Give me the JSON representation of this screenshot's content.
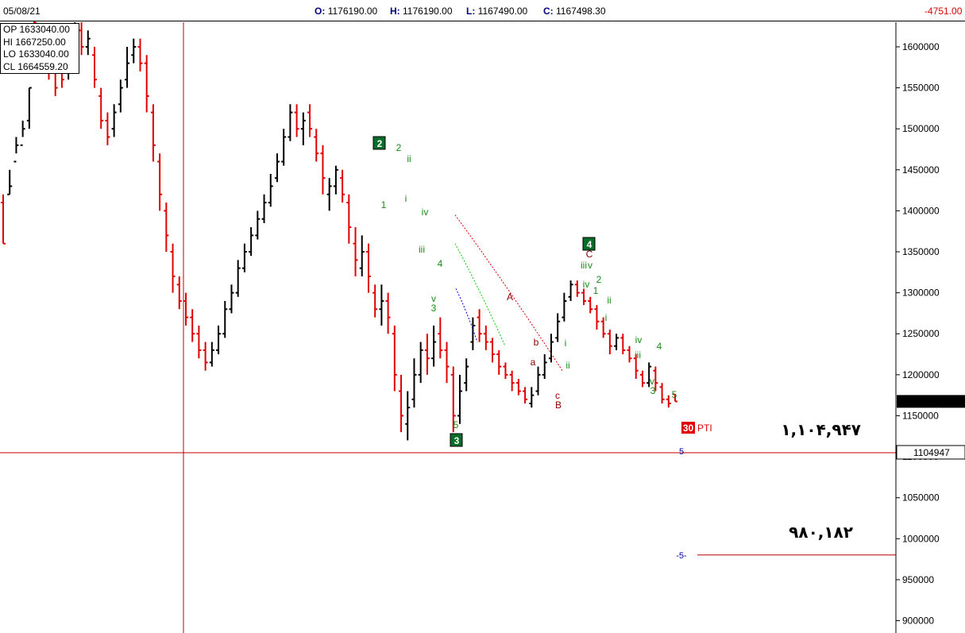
{
  "header": {
    "date": "05/08/21",
    "open_label": "O:",
    "open": "1176190.00",
    "high_label": "H:",
    "high": "1176190.00",
    "low_label": "L:",
    "low": "1167490.00",
    "close_label": "C:",
    "close": "1167498.30",
    "change": "-4751.00"
  },
  "cursor_box": {
    "op_label": "OP",
    "op": "1633040.00",
    "hi_label": "HI",
    "hi": "1667250.00",
    "lo_label": "LO",
    "lo": "1633040.00",
    "cl_label": "CL",
    "cl": "1664559.20"
  },
  "colors": {
    "up": "#000000",
    "down": "#e00000",
    "wave_green": "#1a8a1a",
    "wave_maroon": "#8b0000",
    "badge_green": "#0a6e2a",
    "channel_red": "#e00000",
    "channel_green": "#00cc00",
    "channel_blue": "#0000cc",
    "crosshair": "#c00000",
    "pti_red": "#e00000",
    "projection_blue": "#0000aa"
  },
  "chart_data": {
    "type": "bar",
    "title": "",
    "ylim": [
      885000,
      1630000
    ],
    "y_ticks": [
      900000,
      950000,
      1000000,
      1050000,
      1100000,
      1150000,
      1200000,
      1250000,
      1300000,
      1350000,
      1400000,
      1450000,
      1500000,
      1550000,
      1600000
    ],
    "y_tick_labels": [
      "900000",
      "950000",
      "1000000",
      "1050000",
      "1100000",
      "1150000",
      "1200000",
      "1250000",
      "1300000",
      "1350000",
      "1400000",
      "1450000",
      "1500000",
      "1550000",
      "1600000"
    ],
    "last_price": 1167498,
    "last_price_label": "1167498",
    "crosshair_price": 1104947,
    "crosshair_price_label": "1104947",
    "target_levels": [
      {
        "value": 1104947,
        "text": "۱,۱۰۴,۹۴۷"
      },
      {
        "value": 980182,
        "text": "۹۸۰,۱۸۲"
      }
    ],
    "pti": {
      "number": "30",
      "text": "PTI"
    },
    "projections": [
      {
        "value": 1104947,
        "text": "5"
      },
      {
        "value": 980182,
        "text": "-5-"
      }
    ],
    "bars": [
      [
        1410000,
        1360000,
        1420000,
        1360000
      ],
      [
        1420000,
        1430000,
        1450000,
        1420000
      ],
      [
        1460000,
        1480000,
        1470000,
        1490000
      ],
      [
        1480000,
        1500000,
        1490000,
        1510000
      ],
      [
        1510000,
        1550000,
        1500000,
        1550000
      ],
      [
        1630000,
        1610000,
        1630000,
        1600000
      ],
      [
        1620000,
        1600000,
        1620000,
        1590000
      ],
      [
        1600000,
        1570000,
        1610000,
        1560000
      ],
      [
        1580000,
        1550000,
        1590000,
        1540000
      ],
      [
        1590000,
        1560000,
        1600000,
        1550000
      ],
      [
        1580000,
        1600000,
        1560000,
        1610000
      ],
      [
        1600000,
        1620000,
        1590000,
        1630000
      ],
      [
        1620000,
        1600000,
        1630000,
        1590000
      ],
      [
        1600000,
        1610000,
        1590000,
        1620000
      ],
      [
        1590000,
        1560000,
        1600000,
        1550000
      ],
      [
        1540000,
        1510000,
        1550000,
        1500000
      ],
      [
        1510000,
        1490000,
        1520000,
        1480000
      ],
      [
        1500000,
        1520000,
        1490000,
        1530000
      ],
      [
        1530000,
        1550000,
        1520000,
        1560000
      ],
      [
        1560000,
        1580000,
        1550000,
        1600000
      ],
      [
        1590000,
        1600000,
        1580000,
        1610000
      ],
      [
        1600000,
        1580000,
        1610000,
        1570000
      ],
      [
        1580000,
        1540000,
        1590000,
        1520000
      ],
      [
        1520000,
        1480000,
        1530000,
        1460000
      ],
      [
        1460000,
        1420000,
        1470000,
        1400000
      ],
      [
        1400000,
        1370000,
        1410000,
        1350000
      ],
      [
        1350000,
        1320000,
        1360000,
        1300000
      ],
      [
        1310000,
        1290000,
        1320000,
        1280000
      ],
      [
        1290000,
        1270000,
        1300000,
        1260000
      ],
      [
        1270000,
        1250000,
        1280000,
        1240000
      ],
      [
        1250000,
        1230000,
        1260000,
        1220000
      ],
      [
        1230000,
        1215000,
        1240000,
        1205000
      ],
      [
        1215000,
        1230000,
        1210000,
        1240000
      ],
      [
        1230000,
        1250000,
        1225000,
        1260000
      ],
      [
        1250000,
        1280000,
        1245000,
        1290000
      ],
      [
        1280000,
        1300000,
        1275000,
        1310000
      ],
      [
        1300000,
        1330000,
        1295000,
        1340000
      ],
      [
        1330000,
        1350000,
        1325000,
        1360000
      ],
      [
        1350000,
        1370000,
        1345000,
        1380000
      ],
      [
        1370000,
        1390000,
        1365000,
        1400000
      ],
      [
        1390000,
        1410000,
        1385000,
        1420000
      ],
      [
        1410000,
        1430000,
        1405000,
        1445000
      ],
      [
        1440000,
        1460000,
        1435000,
        1470000
      ],
      [
        1460000,
        1490000,
        1455000,
        1500000
      ],
      [
        1490000,
        1520000,
        1485000,
        1530000
      ],
      [
        1520000,
        1500000,
        1530000,
        1490000
      ],
      [
        1500000,
        1510000,
        1480000,
        1520000
      ],
      [
        1520000,
        1500000,
        1530000,
        1490000
      ],
      [
        1490000,
        1470000,
        1500000,
        1460000
      ],
      [
        1470000,
        1440000,
        1480000,
        1420000
      ],
      [
        1420000,
        1430000,
        1400000,
        1440000
      ],
      [
        1430000,
        1450000,
        1420000,
        1455000
      ],
      [
        1440000,
        1420000,
        1450000,
        1410000
      ],
      [
        1410000,
        1380000,
        1420000,
        1360000
      ],
      [
        1360000,
        1340000,
        1380000,
        1320000
      ],
      [
        1330000,
        1350000,
        1320000,
        1370000
      ],
      [
        1350000,
        1320000,
        1360000,
        1300000
      ],
      [
        1300000,
        1280000,
        1310000,
        1270000
      ],
      [
        1280000,
        1290000,
        1260000,
        1310000
      ],
      [
        1290000,
        1270000,
        1300000,
        1250000
      ],
      [
        1250000,
        1200000,
        1260000,
        1180000
      ],
      [
        1180000,
        1150000,
        1200000,
        1130000
      ],
      [
        1140000,
        1160000,
        1120000,
        1180000
      ],
      [
        1170000,
        1200000,
        1160000,
        1220000
      ],
      [
        1200000,
        1230000,
        1190000,
        1240000
      ],
      [
        1230000,
        1220000,
        1250000,
        1200000
      ],
      [
        1220000,
        1240000,
        1210000,
        1260000
      ],
      [
        1250000,
        1230000,
        1270000,
        1220000
      ],
      [
        1230000,
        1210000,
        1240000,
        1190000
      ],
      [
        1200000,
        1150000,
        1210000,
        1130000
      ],
      [
        1150000,
        1180000,
        1140000,
        1200000
      ],
      [
        1190000,
        1210000,
        1180000,
        1220000
      ],
      [
        1240000,
        1260000,
        1230000,
        1270000
      ],
      [
        1270000,
        1250000,
        1280000,
        1240000
      ],
      [
        1250000,
        1240000,
        1260000,
        1230000
      ],
      [
        1240000,
        1225000,
        1245000,
        1215000
      ],
      [
        1225000,
        1210000,
        1230000,
        1200000
      ],
      [
        1210000,
        1200000,
        1215000,
        1195000
      ],
      [
        1200000,
        1190000,
        1205000,
        1180000
      ],
      [
        1190000,
        1180000,
        1195000,
        1175000
      ],
      [
        1180000,
        1170000,
        1185000,
        1165000
      ],
      [
        1165000,
        1175000,
        1160000,
        1185000
      ],
      [
        1180000,
        1200000,
        1175000,
        1210000
      ],
      [
        1200000,
        1215000,
        1195000,
        1225000
      ],
      [
        1220000,
        1240000,
        1215000,
        1250000
      ],
      [
        1245000,
        1265000,
        1240000,
        1275000
      ],
      [
        1270000,
        1290000,
        1265000,
        1300000
      ],
      [
        1295000,
        1310000,
        1290000,
        1315000
      ],
      [
        1310000,
        1300000,
        1315000,
        1295000
      ],
      [
        1300000,
        1290000,
        1305000,
        1285000
      ],
      [
        1290000,
        1280000,
        1295000,
        1275000
      ],
      [
        1280000,
        1265000,
        1285000,
        1255000
      ],
      [
        1265000,
        1250000,
        1270000,
        1245000
      ],
      [
        1250000,
        1235000,
        1255000,
        1225000
      ],
      [
        1235000,
        1245000,
        1230000,
        1250000
      ],
      [
        1245000,
        1230000,
        1250000,
        1225000
      ],
      [
        1230000,
        1220000,
        1235000,
        1215000
      ],
      [
        1220000,
        1205000,
        1225000,
        1195000
      ],
      [
        1200000,
        1190000,
        1205000,
        1185000
      ],
      [
        1190000,
        1210000,
        1185000,
        1215000
      ],
      [
        1205000,
        1190000,
        1210000,
        1180000
      ],
      [
        1185000,
        1170000,
        1190000,
        1165000
      ],
      [
        1170000,
        1165000,
        1175000,
        1160000
      ],
      [
        1176190,
        1167498,
        1176190,
        1167490
      ]
    ],
    "channels": [
      {
        "color": "red",
        "from": [
          1395000
        ],
        "to": [
          1205000
        ]
      },
      {
        "color": "green",
        "from": [
          1360000
        ],
        "to": [
          1235000
        ]
      },
      {
        "color": "blue",
        "from": [
          1305000
        ],
        "to": [
          1240000
        ]
      }
    ],
    "wave_labels": [
      {
        "text": "2",
        "badge": true
      },
      {
        "text": "2"
      },
      {
        "text": "ii"
      },
      {
        "text": "1"
      },
      {
        "text": "i"
      },
      {
        "text": "iv"
      },
      {
        "text": "iii"
      },
      {
        "text": "4"
      },
      {
        "text": "v"
      },
      {
        "text": "3"
      },
      {
        "text": "5"
      },
      {
        "text": "3",
        "badge": true
      },
      {
        "text": "A"
      },
      {
        "text": "b"
      },
      {
        "text": "a"
      },
      {
        "text": "c"
      },
      {
        "text": "B"
      },
      {
        "text": "i"
      },
      {
        "text": "ii"
      },
      {
        "text": "4",
        "badge": true
      },
      {
        "text": "C"
      },
      {
        "text": "iii"
      },
      {
        "text": "v"
      },
      {
        "text": "iv"
      },
      {
        "text": "2"
      },
      {
        "text": "1"
      },
      {
        "text": "ii"
      },
      {
        "text": "i"
      },
      {
        "text": "iv"
      },
      {
        "text": "iii"
      },
      {
        "text": "4"
      },
      {
        "text": "v"
      },
      {
        "text": "3"
      },
      {
        "text": "5"
      }
    ]
  }
}
